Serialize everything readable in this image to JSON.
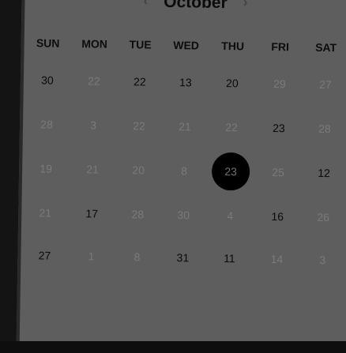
{
  "calendar": {
    "month": "October",
    "prev_icon": "chevron-left-icon",
    "next_icon": "chevron-right-icon",
    "prev_glyph": "‹",
    "next_glyph": "›",
    "weekdays": [
      "SUN",
      "MON",
      "TUE",
      "WED",
      "THU",
      "FRI",
      "SAT"
    ],
    "weeks": [
      [
        {
          "d": "30",
          "muted": false
        },
        {
          "d": "22",
          "muted": true
        },
        {
          "d": "22",
          "muted": false
        },
        {
          "d": "13",
          "muted": false
        },
        {
          "d": "20",
          "muted": false
        },
        {
          "d": "29",
          "muted": true
        },
        {
          "d": "27",
          "muted": true
        }
      ],
      [
        {
          "d": "28",
          "muted": true
        },
        {
          "d": "3",
          "muted": true
        },
        {
          "d": "22",
          "muted": true
        },
        {
          "d": "21",
          "muted": true
        },
        {
          "d": "22",
          "muted": true
        },
        {
          "d": "23",
          "muted": false
        },
        {
          "d": "28",
          "muted": true
        }
      ],
      [
        {
          "d": "19",
          "muted": true
        },
        {
          "d": "21",
          "muted": true
        },
        {
          "d": "20",
          "muted": true
        },
        {
          "d": "8",
          "muted": true
        },
        {
          "d": "23",
          "muted": false,
          "selected": true
        },
        {
          "d": "25",
          "muted": true
        },
        {
          "d": "12",
          "muted": false
        }
      ],
      [
        {
          "d": "21",
          "muted": true
        },
        {
          "d": "17",
          "muted": false
        },
        {
          "d": "28",
          "muted": true
        },
        {
          "d": "30",
          "muted": true
        },
        {
          "d": "4",
          "muted": true
        },
        {
          "d": "16",
          "muted": false
        },
        {
          "d": "26",
          "muted": true
        }
      ],
      [
        {
          "d": "27",
          "muted": false
        },
        {
          "d": "1",
          "muted": true
        },
        {
          "d": "8",
          "muted": true
        },
        {
          "d": "31",
          "muted": false
        },
        {
          "d": "11",
          "muted": false
        },
        {
          "d": "14",
          "muted": true
        },
        {
          "d": "3",
          "muted": true
        }
      ]
    ]
  },
  "colors": {
    "card_bg": "#5e5e5e",
    "frame_bg": "#141414",
    "text_dark": "#0a0a0a",
    "text_muted": "#7a7a7a",
    "selected_bg": "#000000",
    "selected_text": "#6f6f6f"
  }
}
